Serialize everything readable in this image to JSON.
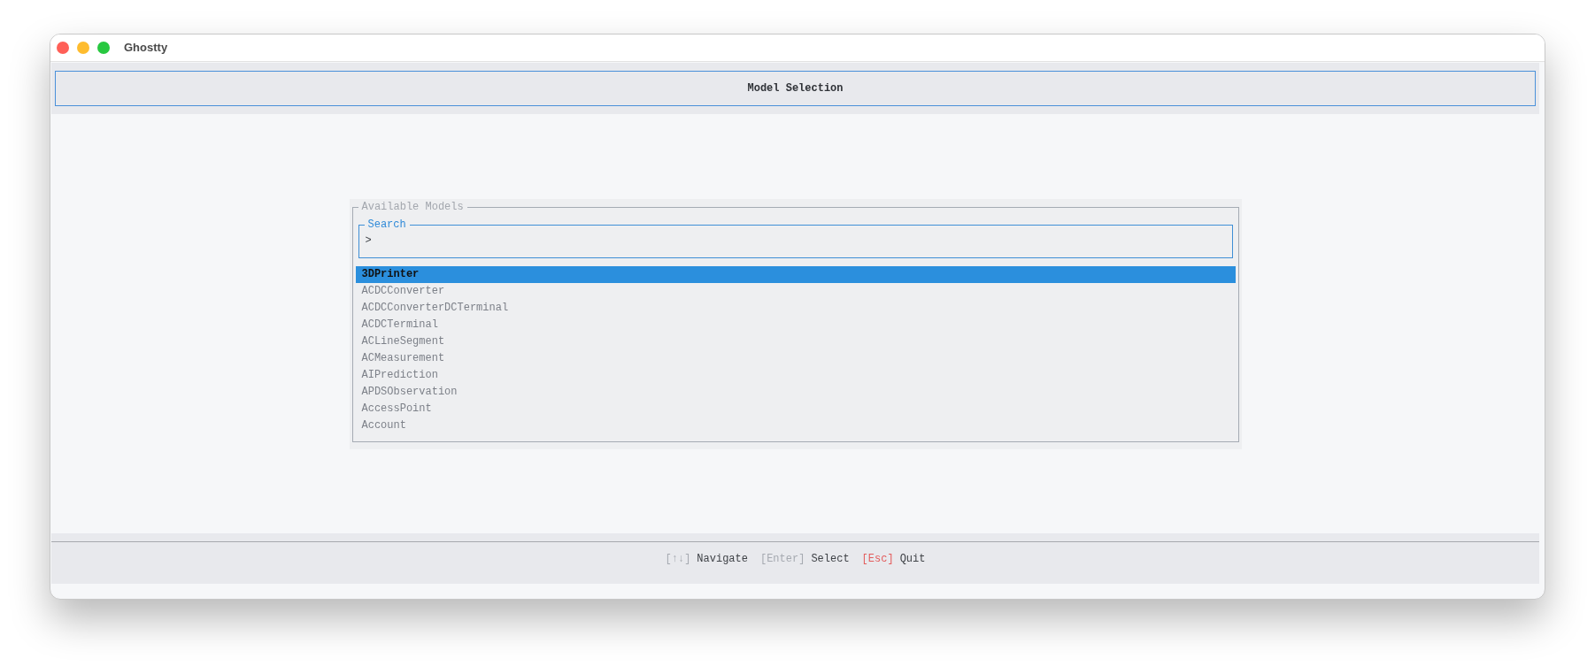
{
  "window": {
    "title": "Ghostty"
  },
  "header": {
    "title": "Model Selection"
  },
  "models_panel": {
    "title": "Available Models",
    "search": {
      "label": "Search",
      "prompt": ">"
    },
    "items": [
      {
        "label": "3DPrinter",
        "selected": true
      },
      {
        "label": "ACDCConverter",
        "selected": false
      },
      {
        "label": "ACDCConverterDCTerminal",
        "selected": false
      },
      {
        "label": "ACDCTerminal",
        "selected": false
      },
      {
        "label": "ACLineSegment",
        "selected": false
      },
      {
        "label": "ACMeasurement",
        "selected": false
      },
      {
        "label": "AIPrediction",
        "selected": false
      },
      {
        "label": "APDSObservation",
        "selected": false
      },
      {
        "label": "AccessPoint",
        "selected": false
      },
      {
        "label": "Account",
        "selected": false
      }
    ]
  },
  "status_bar": {
    "hints": [
      {
        "key": "[↑↓]",
        "action": "Navigate",
        "color": "#a6aab1"
      },
      {
        "key": "[Enter]",
        "action": "Select",
        "color": "#a6aab1"
      },
      {
        "key": "[Esc]",
        "action": "Quit",
        "color": "#e35d5d"
      }
    ]
  }
}
